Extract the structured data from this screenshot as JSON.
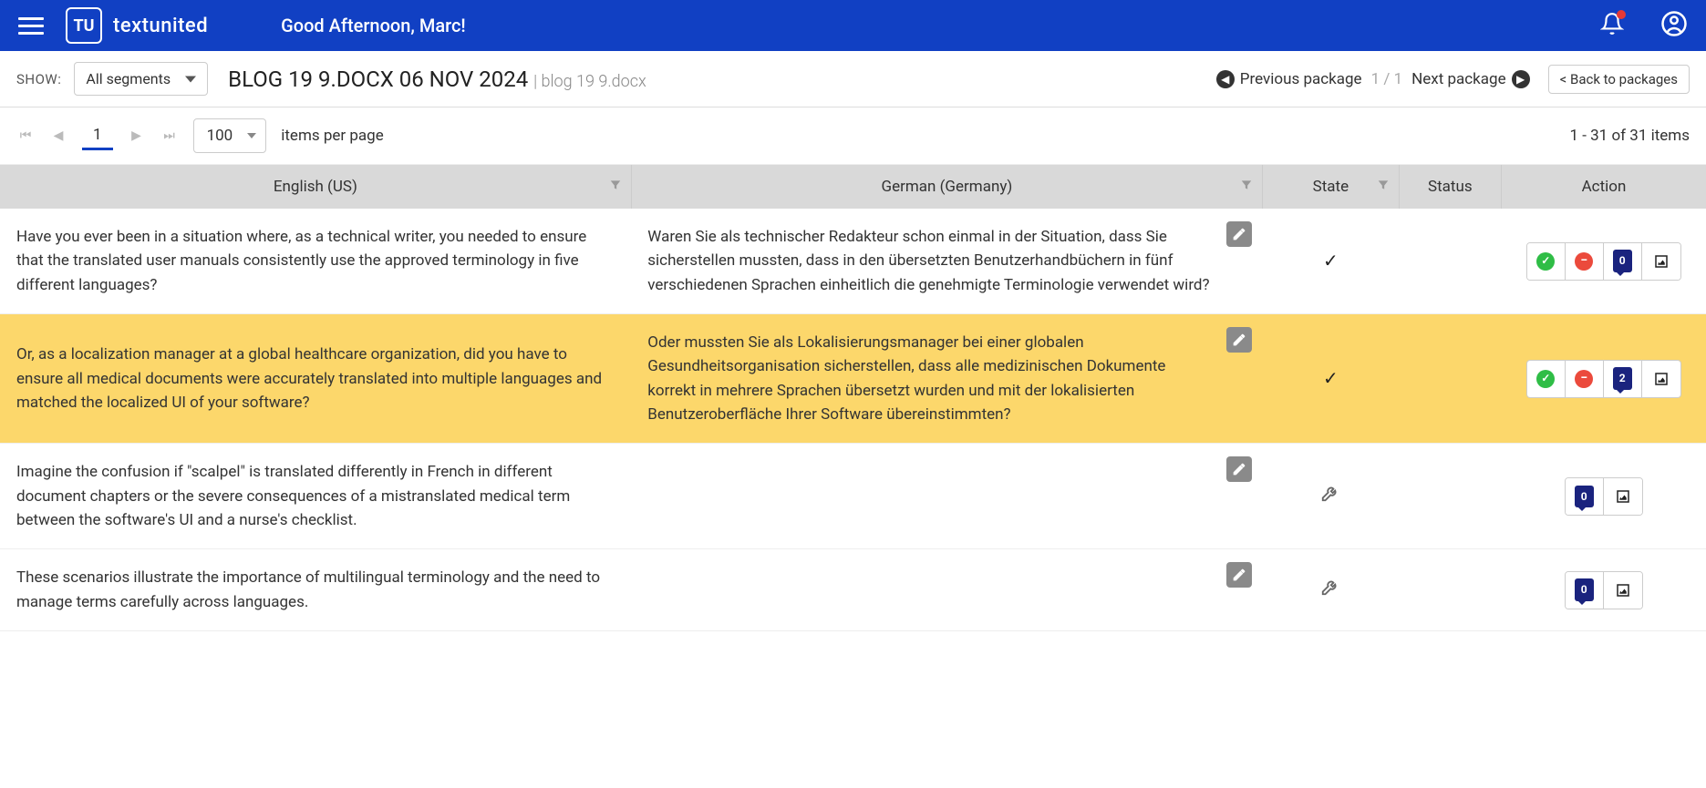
{
  "header": {
    "brand": "textunited",
    "logo_letters": "TU",
    "greeting": "Good Afternoon, Marc!"
  },
  "toolbar": {
    "show_label": "SHOW:",
    "filter_value": "All segments",
    "doc_title": "BLOG 19 9.DOCX 06 NOV 2024",
    "doc_sub": "| blog 19 9.docx",
    "prev_pkg": "Previous package",
    "pkg_count": "1 / 1",
    "next_pkg": "Next package",
    "back_btn": "< Back to packages"
  },
  "pager": {
    "current": "1",
    "page_size": "100",
    "per_page_label": "items per page",
    "range": "1 - 31 of 31 items"
  },
  "columns": {
    "source": "English (US)",
    "target": "German (Germany)",
    "state": "State",
    "status": "Status",
    "action": "Action"
  },
  "rows": [
    {
      "source": "Have you ever been in a situation where, as a technical writer, you needed to ensure that the translated user manuals consistently use the approved terminology in five different languages?",
      "target": "Waren Sie als technischer Redakteur schon einmal in der Situation, dass Sie sicherstellen mussten, dass in den übersetzten Benutzerhandbüchern in fünf verschiedenen Sprachen einheitlich die genehmigte Terminologie verwendet wird?",
      "state": "checked",
      "comments": "0",
      "highlight": false,
      "full_actions": true
    },
    {
      "source": "Or, as a localization manager at a global healthcare organization, did you have to ensure all medical documents were accurately translated into multiple languages and matched the localized UI of your software?",
      "target": "Oder mussten Sie als Lokalisierungsmanager bei einer globalen Gesundheitsorganisation sicherstellen, dass alle medizinischen Dokumente korrekt in mehrere Sprachen übersetzt wurden und mit der lokalisierten Benutzeroberfläche Ihrer Software übereinstimmten?",
      "state": "checked",
      "comments": "2",
      "highlight": true,
      "full_actions": true
    },
    {
      "source": "Imagine the confusion if \"scalpel\" is translated differently in French in different document chapters or the severe consequences of a mistranslated medical term between the software's UI and a nurse's checklist.",
      "target": "",
      "state": "wrench",
      "comments": "0",
      "highlight": false,
      "full_actions": false
    },
    {
      "source": "These scenarios illustrate the importance of multilingual terminology and the need to manage terms carefully across languages.",
      "target": "",
      "state": "wrench",
      "comments": "0",
      "highlight": false,
      "full_actions": false
    }
  ]
}
